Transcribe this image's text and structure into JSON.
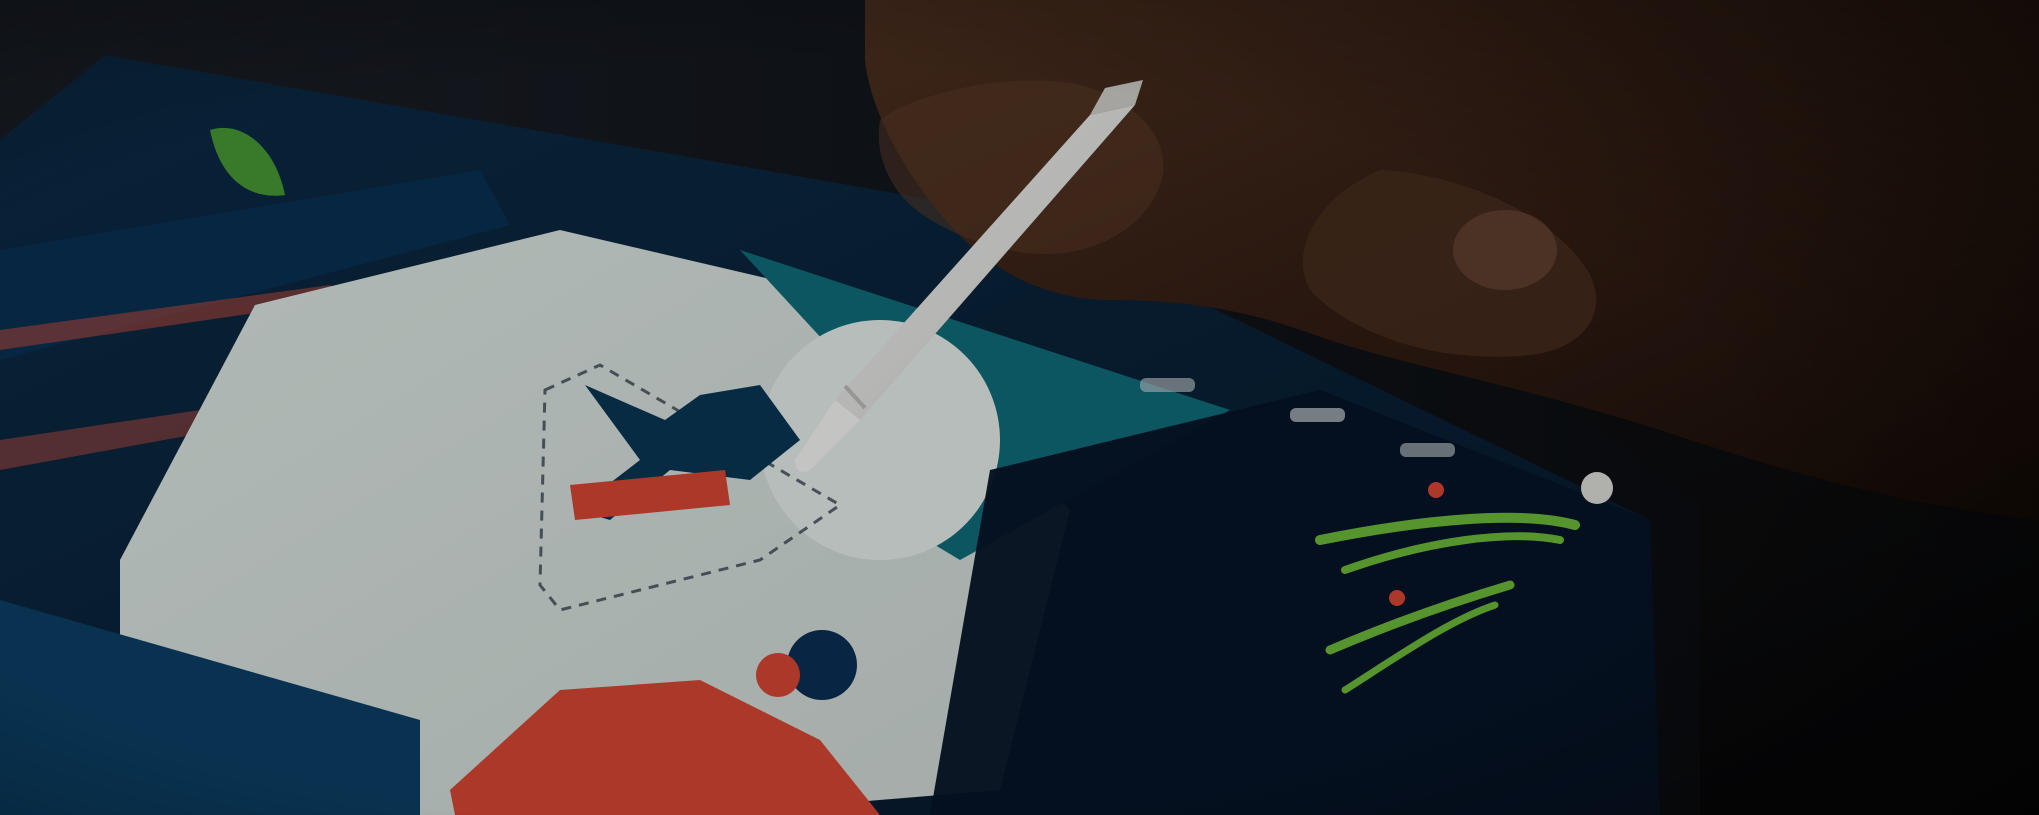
{
  "image": {
    "colors": {
      "background": "#0c0c0e",
      "device_frame": "#0e1116",
      "screen_base": "#061a2f",
      "paper": "#dfe7e3",
      "teal_sky": "#0f6a78",
      "dark_blue_figure": "#0a3554",
      "red_accent": "#d24532",
      "green_plant": "#6fbe3a",
      "hand_skin": "#3b2416",
      "pencil_white": "#e9e9e7"
    },
    "icons": [
      "hand-icon",
      "stylus-icon",
      "tablet-icon"
    ]
  }
}
